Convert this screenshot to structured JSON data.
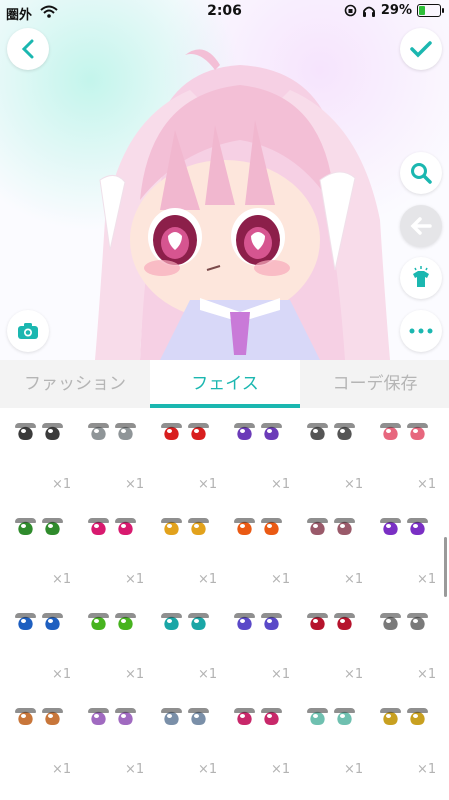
{
  "status_bar": {
    "carrier": "圏外",
    "time": "2:06",
    "battery": "29%"
  },
  "tabs": [
    {
      "label": "ファッション",
      "active": false
    },
    {
      "label": "フェイス",
      "active": true
    },
    {
      "label": "コーデ保存",
      "active": false
    }
  ],
  "colors": {
    "accent": "#1bb7b0",
    "tab_inactive": "#b5b5b5"
  },
  "icons": {
    "back": "chevron-left-icon",
    "confirm": "check-icon",
    "zoom": "search-icon",
    "undo": "arrow-left-icon",
    "outfit": "shirt-sparkle-icon",
    "more": "more-dots-icon",
    "camera": "camera-icon"
  },
  "items": [
    {
      "count": "×1",
      "color": "#3b3b3b"
    },
    {
      "count": "×1",
      "color": "#8f9598"
    },
    {
      "count": "×1",
      "color": "#d81e1e"
    },
    {
      "count": "×1",
      "color": "#6b3bb8"
    },
    {
      "count": "×1",
      "color": "#555555"
    },
    {
      "count": "×1",
      "color": "#e7677e"
    },
    {
      "count": "×1",
      "color": "#2f8b2c"
    },
    {
      "count": "×1",
      "color": "#d81a6f"
    },
    {
      "count": "×1",
      "color": "#e2a21c"
    },
    {
      "count": "×1",
      "color": "#ea5a14"
    },
    {
      "count": "×1",
      "color": "#9a5a6a"
    },
    {
      "count": "×1",
      "color": "#7a2fc4"
    },
    {
      "count": "×1",
      "color": "#1e5fc0"
    },
    {
      "count": "×1",
      "color": "#47b31f"
    },
    {
      "count": "×1",
      "color": "#1aa6a6"
    },
    {
      "count": "×1",
      "color": "#5a49c8"
    },
    {
      "count": "×1",
      "color": "#b6132c"
    },
    {
      "count": "×1",
      "color": "#7a7a7a"
    },
    {
      "count": "×1",
      "color": "#c8763a"
    },
    {
      "count": "×1",
      "color": "#a06ac0"
    },
    {
      "count": "×1",
      "color": "#7a8fa8"
    },
    {
      "count": "×1",
      "color": "#c8286a"
    },
    {
      "count": "×1",
      "color": "#6fc0b0"
    },
    {
      "count": "×1",
      "color": "#c8a020"
    }
  ]
}
